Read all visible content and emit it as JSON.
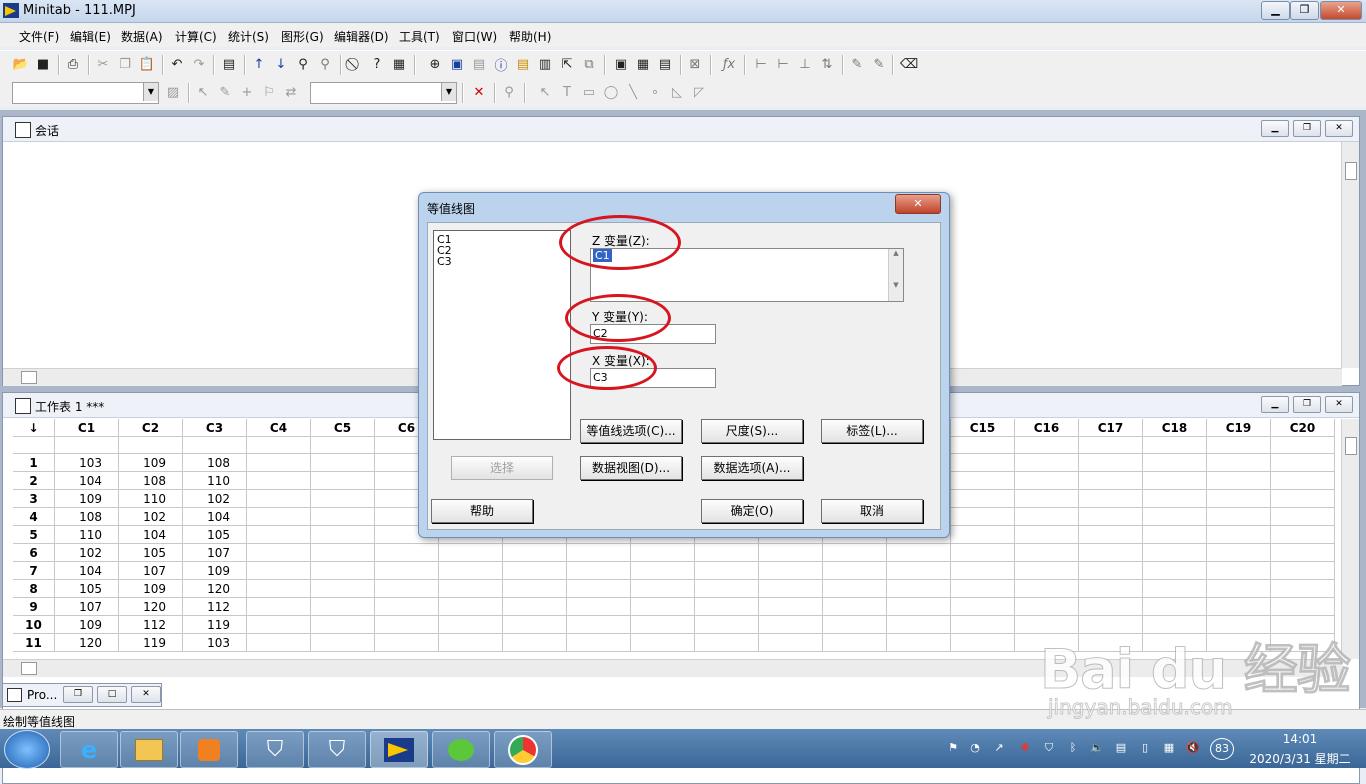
{
  "window": {
    "title": "Minitab - 111.MPJ",
    "min": "▁",
    "max": "❐",
    "close": "✕"
  },
  "menu": [
    "文件(F)",
    "编辑(E)",
    "数据(A)",
    "计算(C)",
    "统计(S)",
    "图形(G)",
    "编辑器(D)",
    "工具(T)",
    "窗口(W)",
    "帮助(H)"
  ],
  "session": {
    "title": "会话"
  },
  "worksheet": {
    "title": "工作表 1 ***",
    "corner": "↓",
    "columns": [
      "C1",
      "C2",
      "C3",
      "C4",
      "C5",
      "C6",
      "C7",
      "C8",
      "C9",
      "C10",
      "C11",
      "C12",
      "C13",
      "C14",
      "C15",
      "C16",
      "C17",
      "C18",
      "C19",
      "C20"
    ],
    "rows": [
      {
        "n": "1",
        "v": [
          "103",
          "109",
          "108"
        ]
      },
      {
        "n": "2",
        "v": [
          "104",
          "108",
          "110"
        ]
      },
      {
        "n": "3",
        "v": [
          "109",
          "110",
          "102"
        ]
      },
      {
        "n": "4",
        "v": [
          "108",
          "102",
          "104"
        ]
      },
      {
        "n": "5",
        "v": [
          "110",
          "104",
          "105"
        ]
      },
      {
        "n": "6",
        "v": [
          "102",
          "105",
          "107"
        ]
      },
      {
        "n": "7",
        "v": [
          "104",
          "107",
          "109"
        ]
      },
      {
        "n": "8",
        "v": [
          "105",
          "109",
          "120"
        ]
      },
      {
        "n": "9",
        "v": [
          "107",
          "120",
          "112"
        ]
      },
      {
        "n": "10",
        "v": [
          "109",
          "112",
          "119"
        ]
      },
      {
        "n": "11",
        "v": [
          "120",
          "119",
          "103"
        ]
      }
    ]
  },
  "dialog": {
    "title": "等值线图",
    "close": "✕",
    "variable_list": [
      "C1",
      "C2",
      "C3"
    ],
    "z_label": "Z 变量(Z):",
    "z_value": "C1",
    "y_label": "Y 变量(Y):",
    "y_value": "C2",
    "x_label": "X 变量(X):",
    "x_value": "C3",
    "buttons": {
      "contour_options": "等值线选项(C)...",
      "scale": "尺度(S)...",
      "labels": "标签(L)...",
      "select": "选择",
      "data_view": "数据视图(D)...",
      "data_options": "数据选项(A)...",
      "help": "帮助",
      "ok": "确定(O)",
      "cancel": "取消"
    },
    "highlight_color": "#d6151f"
  },
  "project_window": {
    "title": "Pro..."
  },
  "status_bar": {
    "text": "绘制等值线图"
  },
  "taskbar": {
    "apps": [
      "windows-start-icon",
      "ie-icon",
      "explorer-icon",
      "media-player-icon",
      "security-shield-icon",
      "security-shield-icon",
      "minitab-icon",
      "wechat-icon",
      "chrome-icon"
    ],
    "tray_badge": "83",
    "time": "14:01",
    "date": "2020/3/31 星期二"
  },
  "watermark": {
    "brand": "Bai du 经验",
    "url": "jingyan.baidu.com"
  }
}
